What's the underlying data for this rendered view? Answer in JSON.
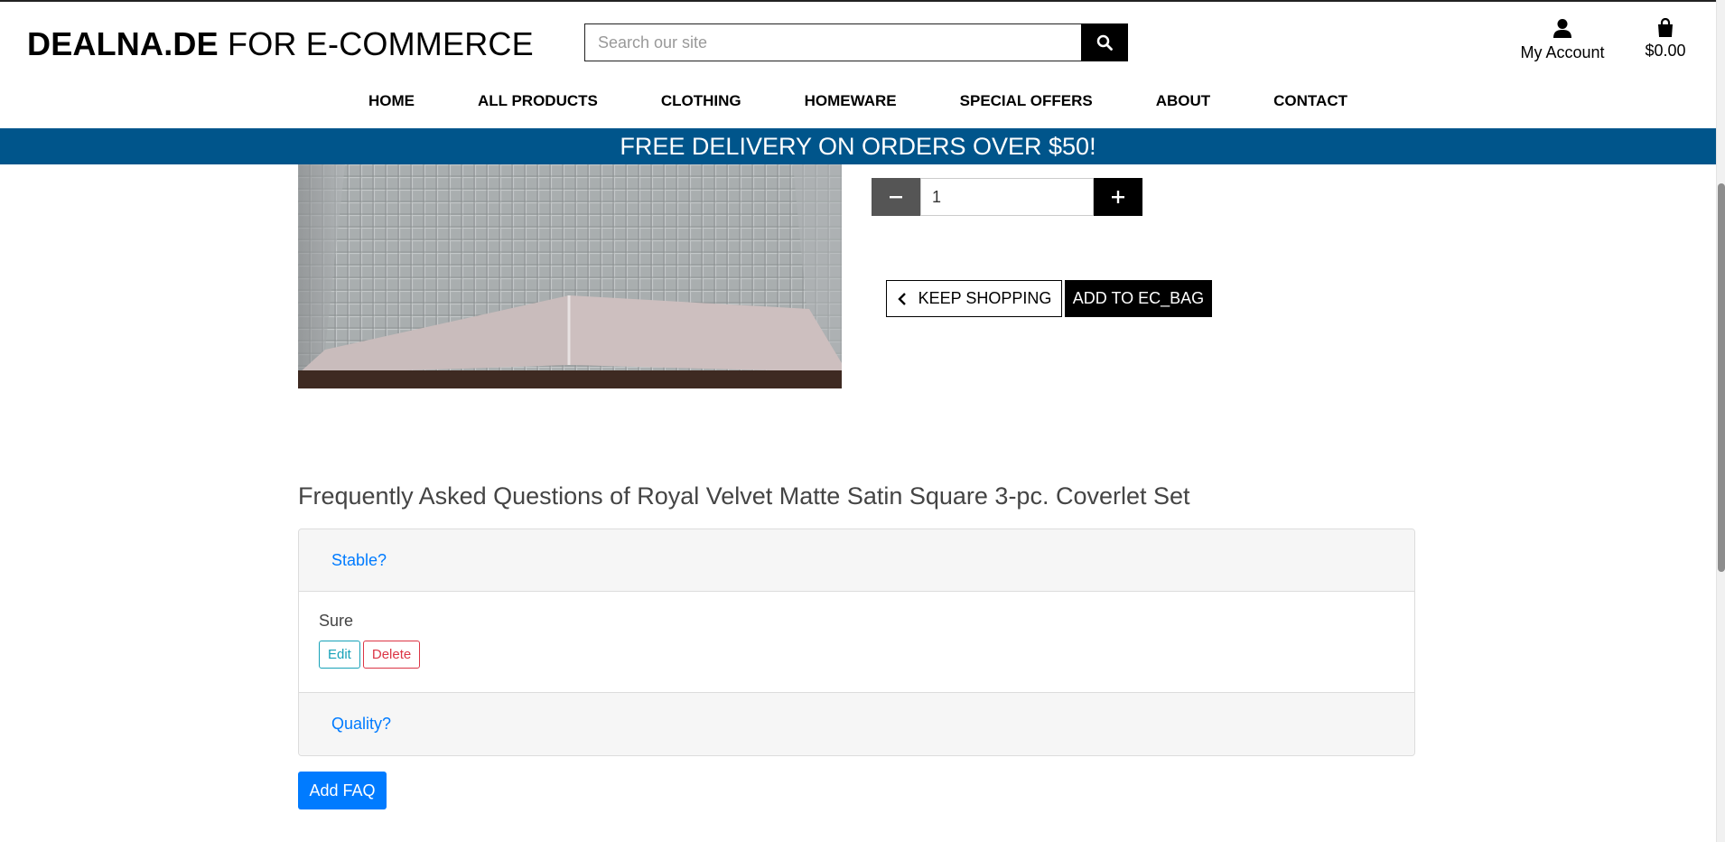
{
  "header": {
    "logo_bold": "DEALNA.DE",
    "logo_rest": " FOR E-COMMERCE",
    "search_placeholder": "Search our site",
    "account_label": "My Account",
    "bag_total": "$0.00"
  },
  "nav": {
    "items": [
      {
        "label": "HOME"
      },
      {
        "label": "ALL PRODUCTS"
      },
      {
        "label": "CLOTHING"
      },
      {
        "label": "HOMEWARE"
      },
      {
        "label": "SPECIAL OFFERS"
      },
      {
        "label": "ABOUT"
      },
      {
        "label": "CONTACT"
      }
    ]
  },
  "banner": "FREE DELIVERY ON ORDERS OVER $50!",
  "product": {
    "quantity": "1",
    "keep_shopping": "KEEP SHOPPING",
    "add_to_bag": "ADD TO EC_BAG"
  },
  "faq": {
    "title": "Frequently Asked Questions of Royal Velvet Matte Satin Square 3-pc. Coverlet Set",
    "items": [
      {
        "question": "Stable?",
        "answer": "Sure",
        "edit_label": "Edit",
        "delete_label": "Delete"
      },
      {
        "question": "Quality?"
      }
    ],
    "add_label": "Add FAQ"
  },
  "colors": {
    "banner": "#00558b",
    "link": "#007bff",
    "edit": "#17a2b8",
    "delete": "#dc3545"
  },
  "icons": [
    "search-icon",
    "user-icon",
    "shopping-bag-icon",
    "minus-icon",
    "plus-icon",
    "chevron-left-icon"
  ]
}
